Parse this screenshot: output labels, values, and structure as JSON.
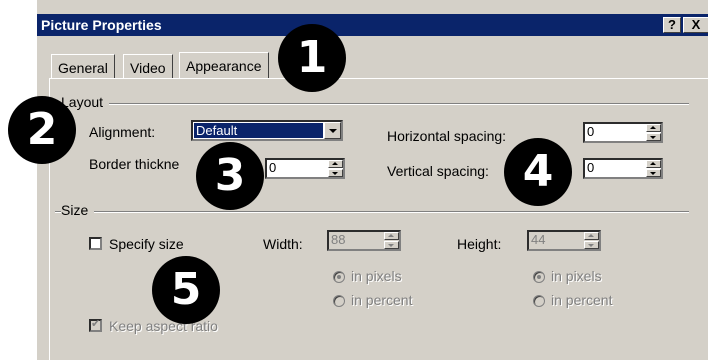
{
  "window": {
    "title": "Picture Properties",
    "help_label": "?",
    "close_label": "X"
  },
  "tabs": [
    {
      "label": "General"
    },
    {
      "label": "Video"
    },
    {
      "label": "Appearance"
    }
  ],
  "layout": {
    "group_label": "Layout",
    "alignment_label": "Alignment:",
    "alignment_value": "Default",
    "border_label": "Border thickne",
    "border_value": "0",
    "hspacing_label": "Horizontal spacing:",
    "hspacing_value": "0",
    "vspacing_label": "Vertical spacing:",
    "vspacing_value": "0"
  },
  "size": {
    "group_label": "Size",
    "specify_label": "Specify size",
    "specify_checked": false,
    "width_label": "Width:",
    "width_value": "88",
    "height_label": "Height:",
    "height_value": "44",
    "width_unit_pixels": "in pixels",
    "width_unit_percent": "in percent",
    "height_unit_pixels": "in pixels",
    "height_unit_percent": "in percent",
    "keep_aspect_label": "Keep aspect ratio",
    "keep_aspect_checked": true
  },
  "callouts": [
    "1",
    "2",
    "3",
    "4",
    "5"
  ],
  "colors": {
    "titlebar": "#0a246a",
    "dialog_face": "#d4d0c8",
    "callout_fill": "#000000"
  }
}
